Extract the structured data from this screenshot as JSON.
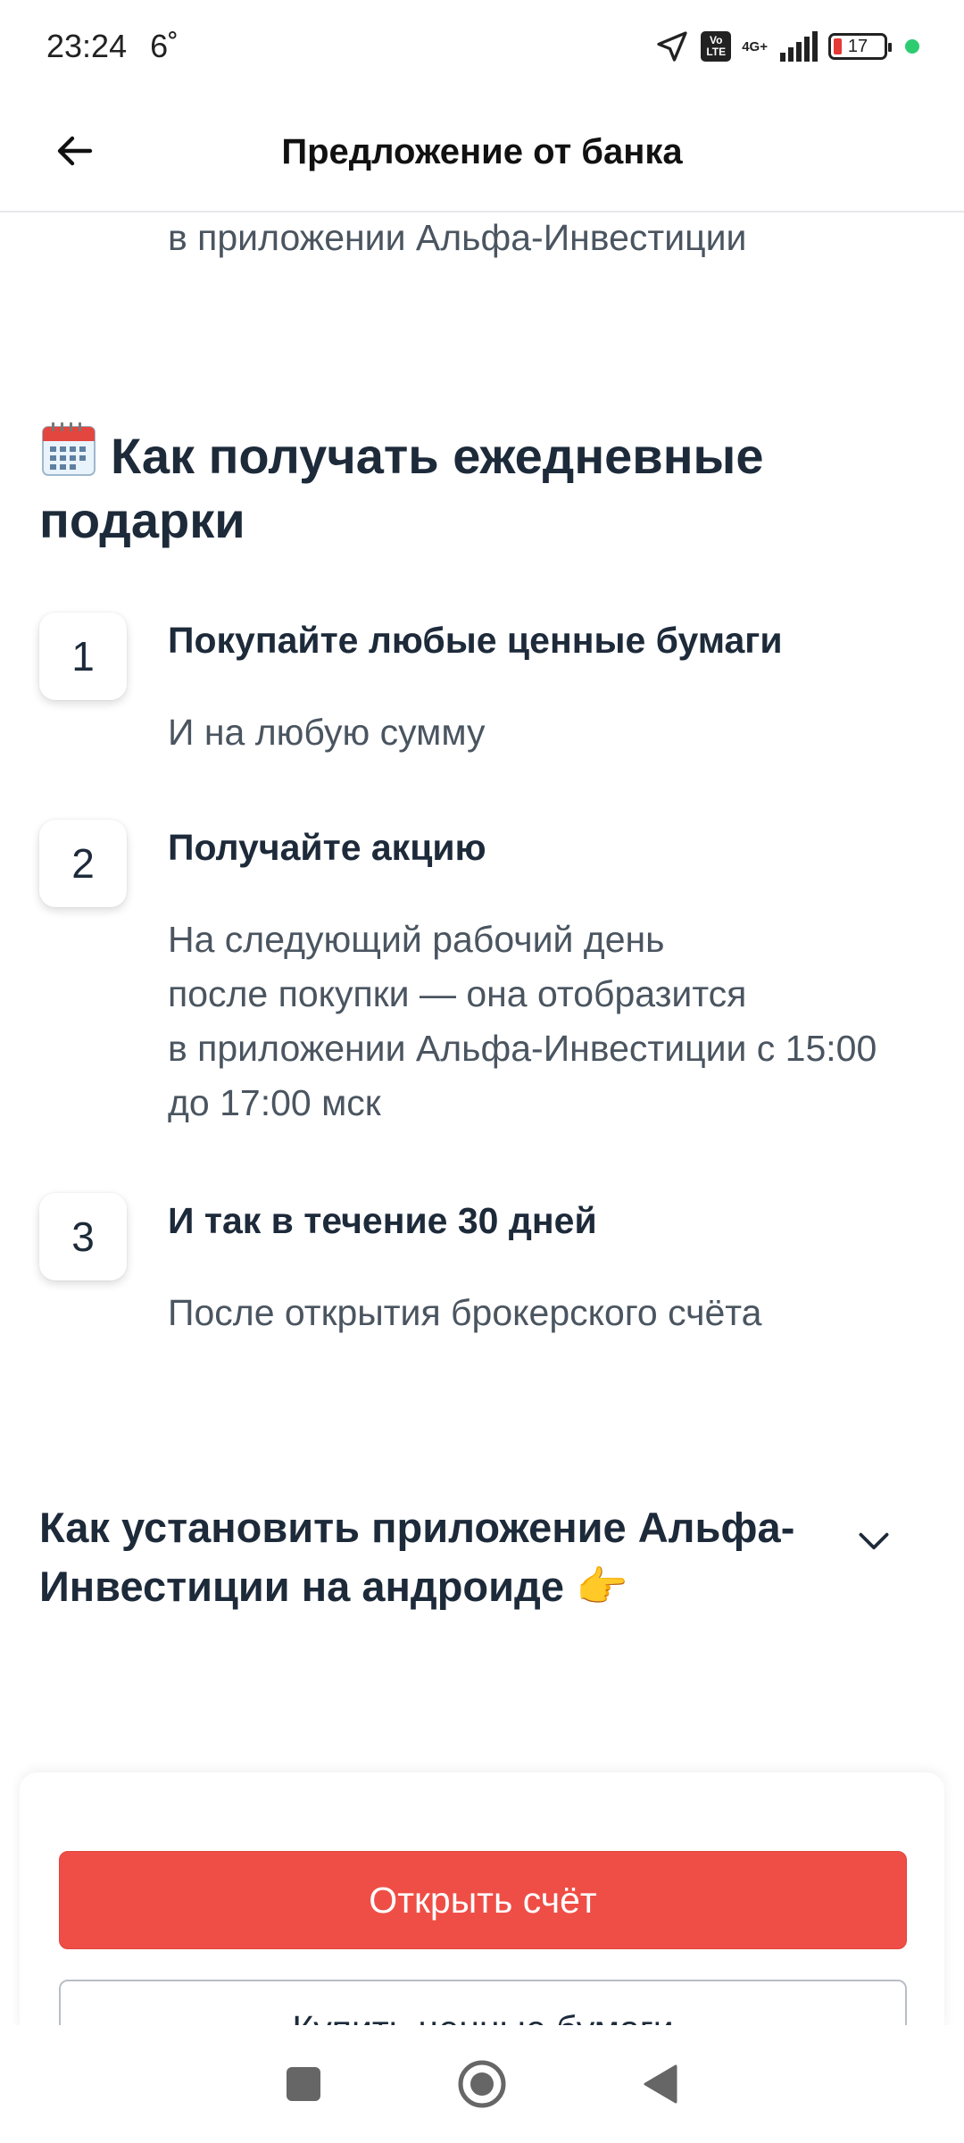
{
  "status_bar": {
    "time": "23:24",
    "temperature": "6˚",
    "network": "4G+",
    "volte": [
      "Vo",
      "LTE"
    ],
    "battery": "17"
  },
  "header": {
    "title": "Предложение от банка",
    "back_icon": "arrow-left-icon"
  },
  "carry_text": "в приложении Альфа-Инвестиции",
  "section": {
    "icon": "calendar-icon",
    "title": "Как получать ежедневные подарки"
  },
  "steps": [
    {
      "number": "1",
      "title": "Покупайте любые ценные бумаги",
      "description": "И на любую сумму"
    },
    {
      "number": "2",
      "title": "Получайте акцию",
      "description": "На следующий рабочий день\nпосле покупки — она отобразится\nв приложении Альфа-Инвестиции с 15:00\nдо 17:00 мск"
    },
    {
      "number": "3",
      "title": "И так в течение 30 дней",
      "description": "После открытия брокерского счёта"
    }
  ],
  "accordion": {
    "title": "Как установить приложение Альфа-Инвестиции на андроиде 👉",
    "icon": "chevron-down-icon"
  },
  "actions": {
    "primary_label": "Открыть счёт",
    "secondary_label": "Купить ценные бумаги"
  },
  "colors": {
    "primary": "#ef4e46",
    "text": "#1d2a3a",
    "muted": "#4a5560"
  }
}
